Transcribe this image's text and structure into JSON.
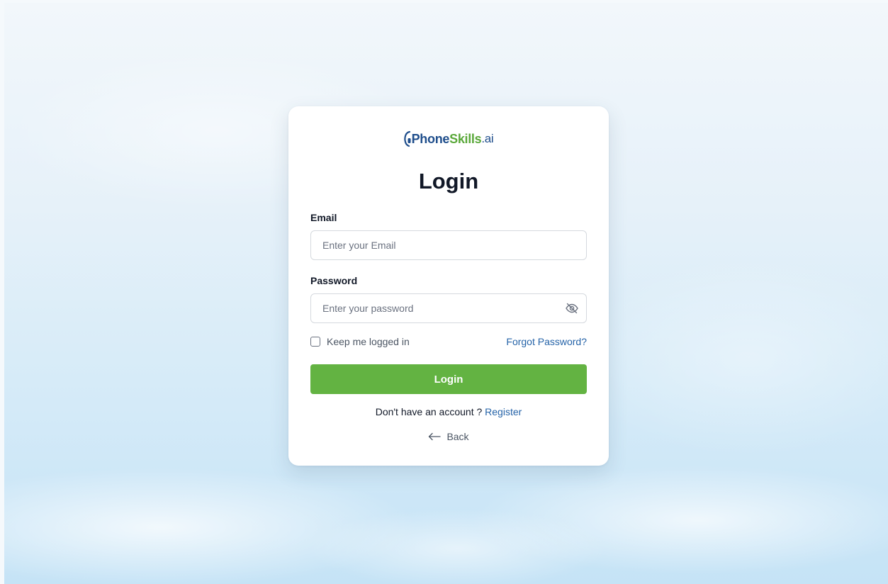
{
  "logo": {
    "part1": "Phone",
    "part2": "Skills",
    "part3": ".ai",
    "colors": {
      "primary": "#1f4e8c",
      "secondary": "#5aa83a"
    }
  },
  "title": "Login",
  "email": {
    "label": "Email",
    "placeholder": "Enter your Email",
    "value": ""
  },
  "password": {
    "label": "Password",
    "placeholder": "Enter your password",
    "value": "",
    "toggle_icon": "eye-off-icon"
  },
  "keep_logged_in": {
    "label": "Keep me logged in",
    "checked": false
  },
  "forgot_password": "Forgot Password?",
  "login_button": "Login",
  "register": {
    "prompt": "Don't have an account ?",
    "link": "Register"
  },
  "back": {
    "label": "Back",
    "icon": "arrow-left-icon"
  },
  "colors": {
    "accent": "#63b342",
    "link": "#2563a8"
  }
}
